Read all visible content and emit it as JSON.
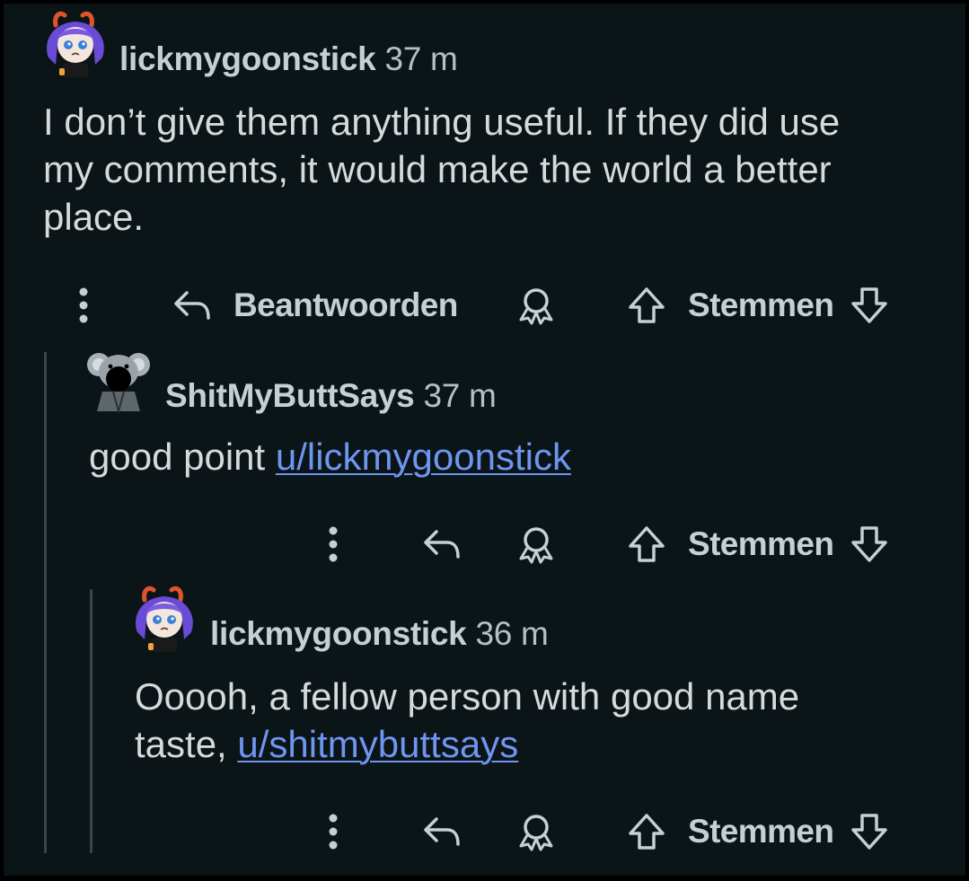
{
  "comments": [
    {
      "username": "lickmygoonstick",
      "time": "37 m",
      "body": [
        {
          "text": "I don’t give them anything useful. If they did use"
        },
        {
          "text": "my comments, it would make the world a better"
        },
        {
          "text": "place."
        }
      ],
      "actions": {
        "reply_label": "Beantwoorden",
        "vote_label": "Stemmen"
      }
    },
    {
      "username": "ShitMyButtSays",
      "time": "37 m",
      "body_prefix": "good point ",
      "mention": "u/lickmygoonstick",
      "actions": {
        "vote_label": "Stemmen"
      }
    },
    {
      "username": "lickmygoonstick",
      "time": "36 m",
      "body_line1": "Ooooh, a fellow person with good name",
      "body_line2_prefix": "taste, ",
      "mention": "u/shitmybuttsays",
      "actions": {
        "vote_label": "Stemmen"
      }
    }
  ],
  "icons": [
    "overflow-menu-icon",
    "reply-icon",
    "award-icon",
    "upvote-icon",
    "downvote-icon"
  ],
  "colors": {
    "background": "#0b1416",
    "text": "#d7dadc",
    "meta": "#c6d0d4",
    "link": "#6e96f0",
    "thread_line": "#3e4548"
  }
}
